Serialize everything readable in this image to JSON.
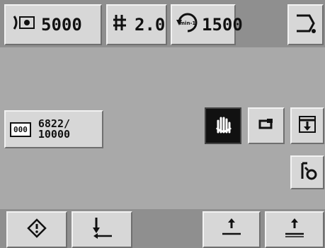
{
  "top_bar": {
    "stitch_count": "5000",
    "stitch_length": "2.0",
    "speed": "1500",
    "speed_unit": "min-1"
  },
  "counter": {
    "label": "000",
    "current": "6822/",
    "total": "10000"
  },
  "icons": {
    "stitch_count": "stitch-counter-icon",
    "stitch_length": "stitch-length-icon",
    "speed": "speed-dial-icon",
    "exit": "exit-icon",
    "hand": "hand-stop-icon",
    "presser_foot": "presser-foot-icon",
    "thread_cut": "thread-cut-icon",
    "bobbin": "bobbin-winder-icon",
    "info": "info-diamond-icon",
    "back_tack": "back-tack-icon",
    "start_tack": "start-tack-icon",
    "end_tack": "end-tack-icon"
  },
  "colors": {
    "background": "#a9a9a9",
    "bar": "#8f8f8f",
    "button": "#d7d7d7",
    "active": "#111111"
  }
}
